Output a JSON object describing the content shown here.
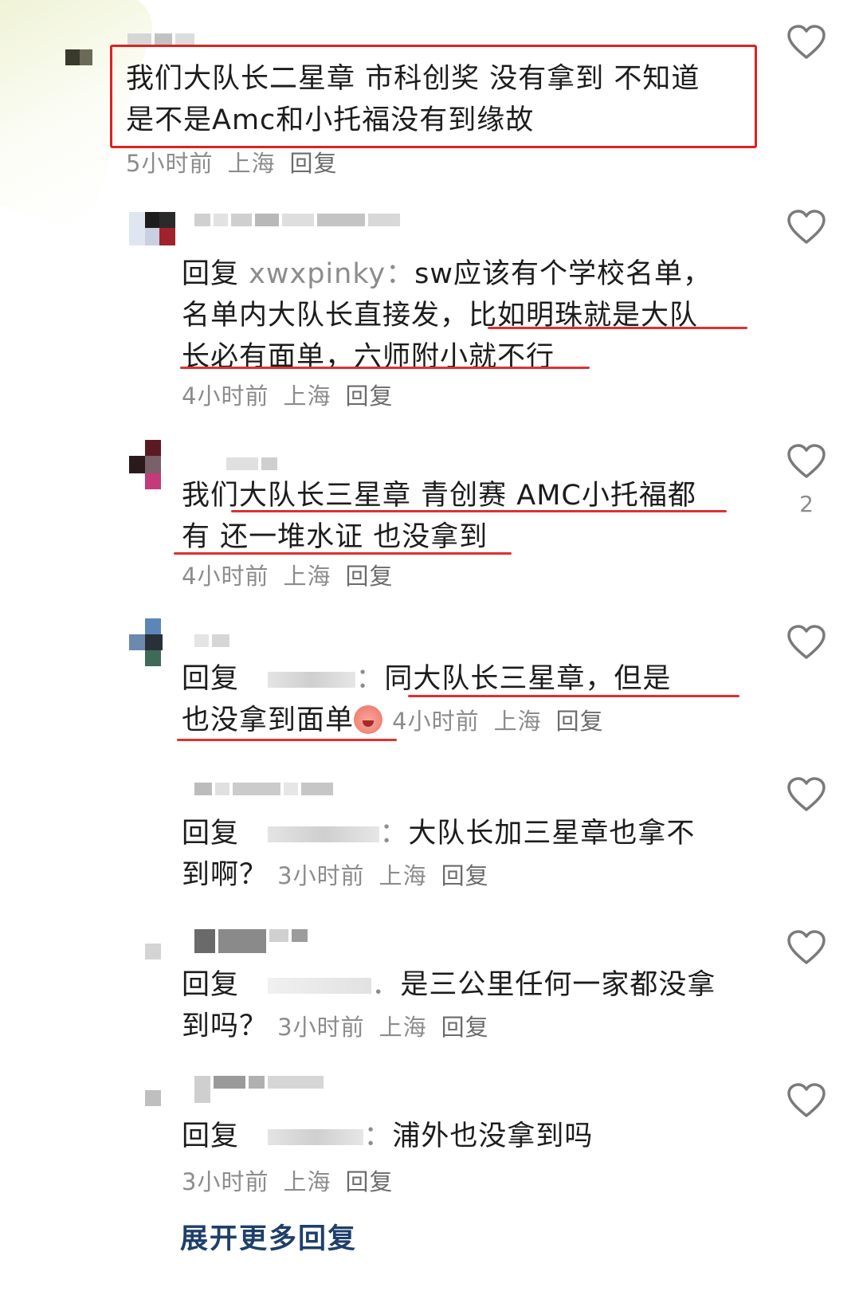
{
  "comments": [
    {
      "text_lines": [
        "我们大队长二星章 市科创奖 没有拿到 不知道",
        "是不是Amc和小托福没有到缘故"
      ],
      "time": "5小时前",
      "location": "上海",
      "reply_label": "回复",
      "likes": ""
    },
    {
      "reply_prefix": "回复",
      "mention": "xwxpinky",
      "text_lines": [
        "sw应该有个学校名单，",
        "名单内大队长直接发，比如明珠就是大队",
        "长必有面单，六师附小就不行"
      ],
      "time": "4小时前",
      "location": "上海",
      "reply_label": "回复",
      "likes": ""
    },
    {
      "text_lines": [
        "我们大队长三星章 青创赛 AMC小托福都",
        "有 还一堆水证 也没拿到"
      ],
      "time": "4小时前",
      "location": "上海",
      "reply_label": "回复",
      "likes": "2"
    },
    {
      "reply_prefix": "回复",
      "text_lines": [
        "同大队长三星章，但是",
        "也没拿到面单"
      ],
      "time": "4小时前",
      "location": "上海",
      "reply_label": "回复",
      "likes": ""
    },
    {
      "reply_prefix": "回复",
      "text_lines": [
        "大队长加三星章也拿不",
        "到啊？"
      ],
      "time": "3小时前",
      "location": "上海",
      "reply_label": "回复",
      "likes": ""
    },
    {
      "reply_prefix": "回复",
      "text_lines": [
        "是三公里任何一家都没拿",
        "到吗？"
      ],
      "time": "3小时前",
      "location": "上海",
      "reply_label": "回复",
      "likes": ""
    },
    {
      "reply_prefix": "回复",
      "text_lines": [
        "浦外也没拿到吗"
      ],
      "time": "3小时前",
      "location": "上海",
      "reply_label": "回复",
      "likes": ""
    }
  ],
  "expand_more": "展开更多回复",
  "colors": {
    "highlight": "#e02020",
    "underline": "#e03030",
    "link": "#1e3f6a",
    "meta": "#8c8c8c"
  },
  "icons": {
    "like": "heart-outline-icon"
  }
}
